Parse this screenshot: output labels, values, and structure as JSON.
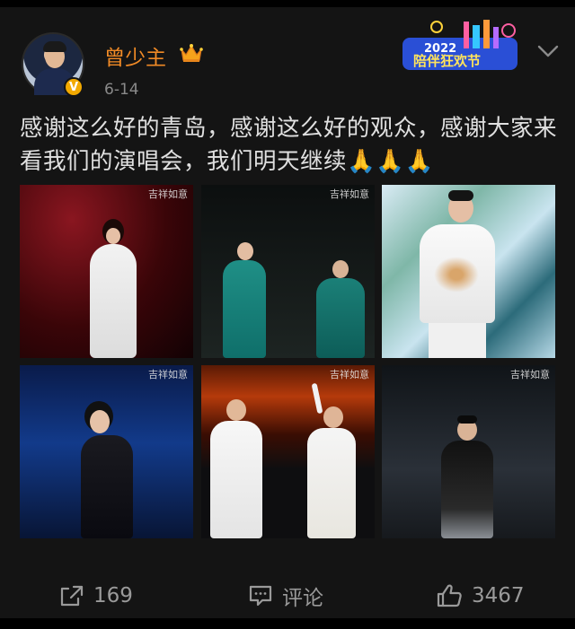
{
  "post": {
    "username": "曾少主",
    "date": "6-14",
    "verified_badge": "V",
    "text": "感谢这么好的青岛，感谢这么好的观众，感谢大家来看我们的演唱会，我们明天继续🙏🙏🙏",
    "event_badge": {
      "year": "2022",
      "title": "陪伴狂欢节"
    },
    "photo_watermark": "吉祥如意"
  },
  "actions": {
    "share_count": "169",
    "comment_label": "评论",
    "like_count": "3467"
  },
  "colors": {
    "background": "#141414",
    "username": "#f08a26",
    "text": "#e0e0e0",
    "muted": "#8a8a8a",
    "badge": "#f2a900"
  },
  "icons": [
    "crown-icon",
    "chevron-down-icon",
    "share-icon",
    "comment-icon",
    "like-icon"
  ]
}
